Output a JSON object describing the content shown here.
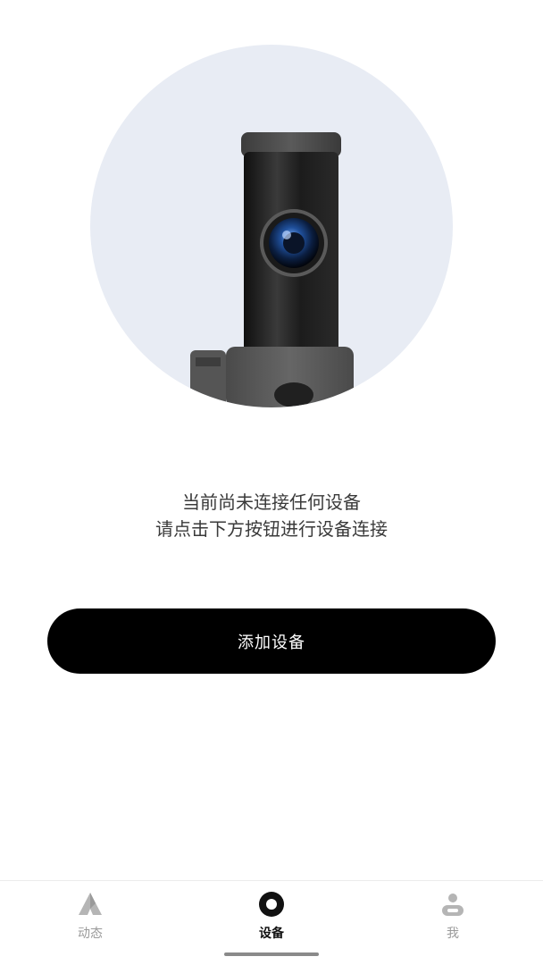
{
  "hero": {
    "illustration": "dashcam-camera-illustration",
    "circle_color": "#e8ecf4"
  },
  "empty_state": {
    "line1": "当前尚未连接任何设备",
    "line2": "请点击下方按钮进行设备连接"
  },
  "primary_button": {
    "label": "添加设备",
    "color": "#000000"
  },
  "tabbar": {
    "tabs": [
      {
        "label": "动态",
        "icon": "feed-icon",
        "active": false
      },
      {
        "label": "设备",
        "icon": "device-icon",
        "active": true
      },
      {
        "label": "我",
        "icon": "profile-icon",
        "active": false
      }
    ]
  }
}
